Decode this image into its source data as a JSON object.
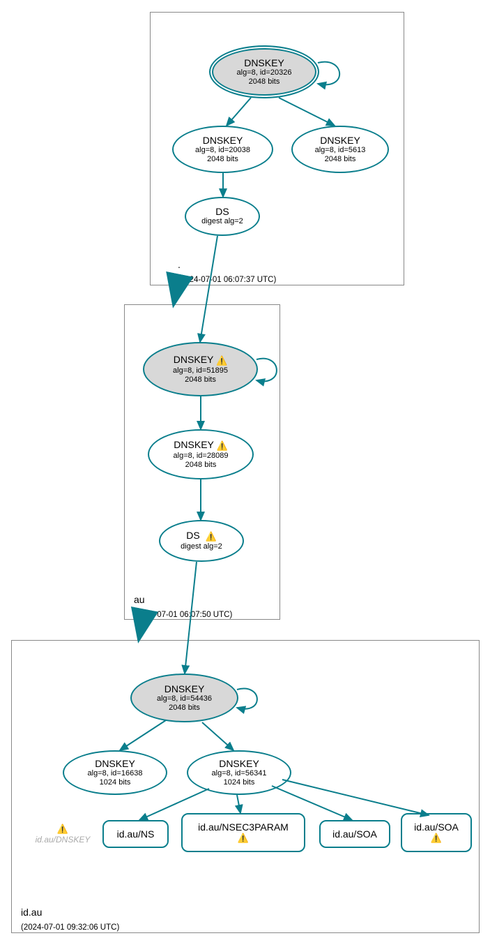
{
  "zones": {
    "root": {
      "name": ".",
      "ts": "(2024-07-01 06:07:37 UTC)"
    },
    "au": {
      "name": "au",
      "ts": "(2024-07-01 06:07:50 UTC)"
    },
    "idau": {
      "name": "id.au",
      "ts": "(2024-07-01 09:32:06 UTC)"
    }
  },
  "nodes": {
    "root_ksk": {
      "title": "DNSKEY",
      "l1": "alg=8, id=20326",
      "l2": "2048 bits"
    },
    "root_zsk1": {
      "title": "DNSKEY",
      "l1": "alg=8, id=20038",
      "l2": "2048 bits"
    },
    "root_zsk2": {
      "title": "DNSKEY",
      "l1": "alg=8, id=5613",
      "l2": "2048 bits"
    },
    "root_ds": {
      "title": "DS",
      "l1": "digest alg=2"
    },
    "au_ksk": {
      "title": "DNSKEY",
      "l1": "alg=8, id=51895",
      "l2": "2048 bits",
      "warn": true
    },
    "au_zsk": {
      "title": "DNSKEY",
      "l1": "alg=8, id=28089",
      "l2": "2048 bits",
      "warn": true
    },
    "au_ds": {
      "title": "DS",
      "l1": "digest alg=2",
      "warn": true
    },
    "idau_ksk": {
      "title": "DNSKEY",
      "l1": "alg=8, id=54436",
      "l2": "2048 bits"
    },
    "idau_zsk1": {
      "title": "DNSKEY",
      "l1": "alg=8, id=16638",
      "l2": "1024 bits"
    },
    "idau_zsk2": {
      "title": "DNSKEY",
      "l1": "alg=8, id=56341",
      "l2": "1024 bits"
    },
    "rr_ns": {
      "label": "id.au/NS"
    },
    "rr_n3p": {
      "label": "id.au/NSEC3PARAM",
      "warn": true
    },
    "rr_soa1": {
      "label": "id.au/SOA"
    },
    "rr_soa2": {
      "label": "id.au/SOA",
      "warn": true
    },
    "rr_dnskey": {
      "label": "id.au/DNSKEY"
    }
  },
  "warn_glyph": "⚠️",
  "colors": {
    "stroke": "#0a7e8c"
  }
}
